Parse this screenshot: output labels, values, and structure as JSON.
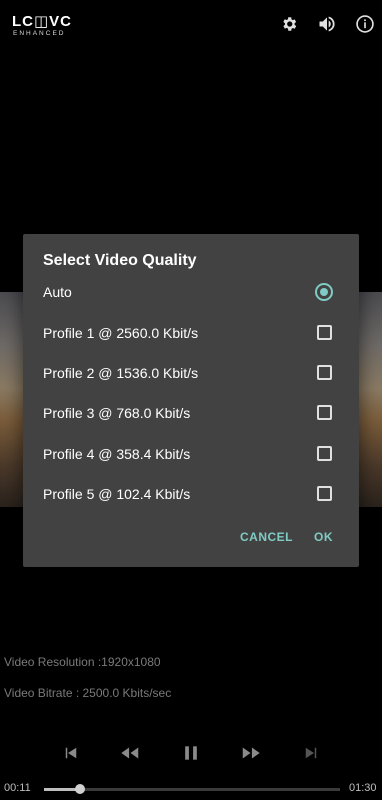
{
  "app": {
    "logo_main": "LC◫VC",
    "logo_sub": "ENHANCED"
  },
  "topbar": {
    "icons": [
      "gear-icon",
      "volume-icon",
      "info-icon"
    ]
  },
  "dialog": {
    "title": "Select Video Quality",
    "options": [
      {
        "label": "Auto",
        "control": "radio",
        "selected": true
      },
      {
        "label": "Profile 1 @ 2560.0 Kbit/s",
        "control": "checkbox",
        "selected": false
      },
      {
        "label": "Profile 2 @ 1536.0 Kbit/s",
        "control": "checkbox",
        "selected": false
      },
      {
        "label": "Profile 3 @ 768.0 Kbit/s",
        "control": "checkbox",
        "selected": false
      },
      {
        "label": "Profile 4 @ 358.4 Kbit/s",
        "control": "checkbox",
        "selected": false
      },
      {
        "label": "Profile 5 @ 102.4 Kbit/s",
        "control": "checkbox",
        "selected": false
      }
    ],
    "cancel_label": "CANCEL",
    "ok_label": "OK",
    "accent": "#80cbc4"
  },
  "info": {
    "resolution": "Video Resolution :1920x1080",
    "bitrate": "Video Bitrate : 2500.0 Kbits/sec"
  },
  "player": {
    "current_time": "00:11",
    "duration": "01:30",
    "progress": 0.12,
    "controls": [
      "skip-previous-icon",
      "rewind-icon",
      "pause-icon",
      "fast-forward-icon",
      "skip-next-icon"
    ]
  }
}
